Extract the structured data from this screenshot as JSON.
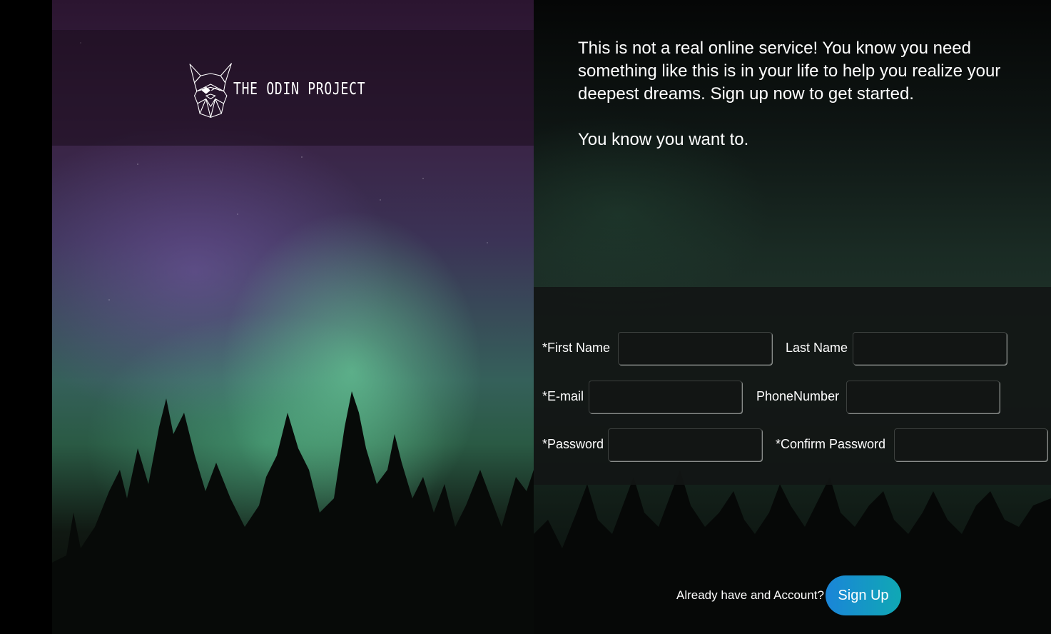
{
  "logo": {
    "text": "THE ODIN PROJECT"
  },
  "intro": {
    "paragraph1": "This is not a real online service! You know you need something like this is in your life to help you realize your deepest dreams. Sign up now to get started.",
    "paragraph2": "You know you want to."
  },
  "form": {
    "first_name_label": "*First Name",
    "first_name_value": "",
    "last_name_label": "Last Name",
    "last_name_value": "",
    "email_label": "*E-mail",
    "email_value": "",
    "phone_label": "PhoneNumber",
    "phone_value": "",
    "password_label": "*Password",
    "password_value": "",
    "confirm_password_label": "*Confirm Password",
    "confirm_password_value": ""
  },
  "footer": {
    "already_text": "Already have and Account?",
    "signup_label": "Sign Up"
  },
  "colors": {
    "button_gradient_start": "#1a85d8",
    "button_gradient_end": "#10a8b4",
    "text": "#ffffff"
  }
}
